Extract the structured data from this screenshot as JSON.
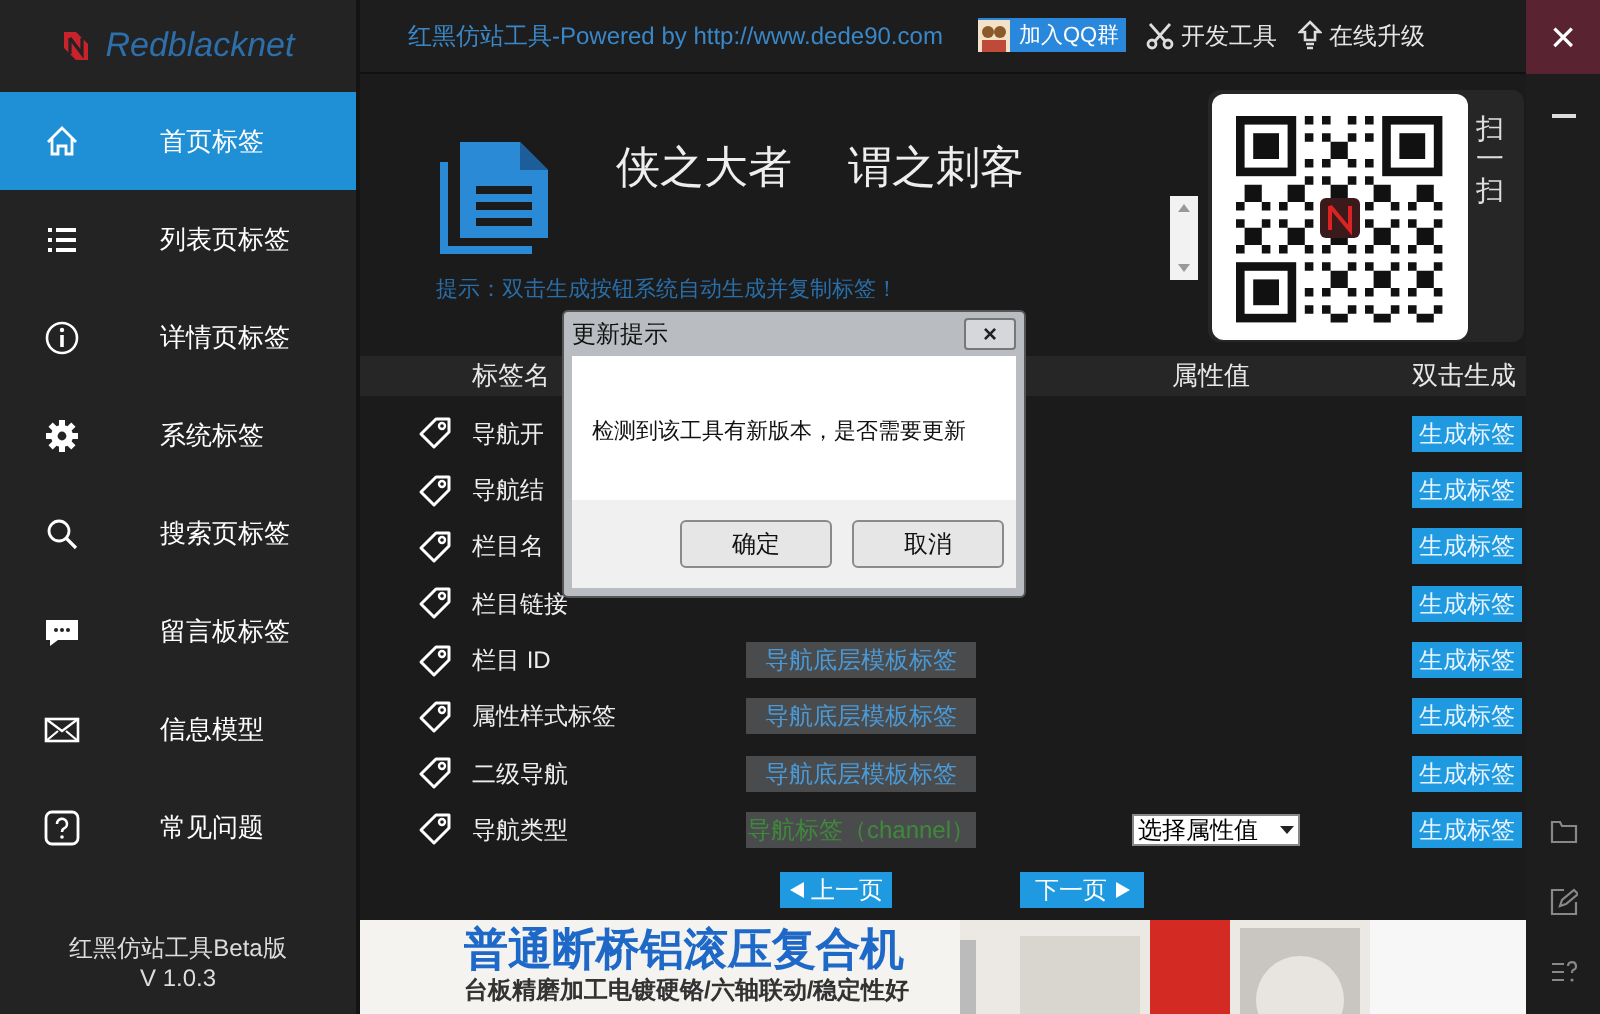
{
  "brand": {
    "name": "Redblacknet"
  },
  "title_bar": {
    "title": "红黑仿站工具-Powered by http://www.dede90.com",
    "qq_button": "加入QQ群",
    "tools": [
      {
        "label": "开发工具"
      },
      {
        "label": "在线升级"
      }
    ],
    "close": "×"
  },
  "sidebar": {
    "items": [
      {
        "label": "首页标签",
        "selected": true
      },
      {
        "label": "列表页标签",
        "selected": false
      },
      {
        "label": "详情页标签",
        "selected": false
      },
      {
        "label": "系统标签",
        "selected": false
      },
      {
        "label": "搜索页标签",
        "selected": false
      },
      {
        "label": "留言板标签",
        "selected": false
      },
      {
        "label": "信息模型",
        "selected": false
      },
      {
        "label": "常见问题",
        "selected": false
      }
    ],
    "footer": [
      "红黑仿站工具Beta版",
      "V 1.0.3"
    ]
  },
  "header": {
    "slogan": [
      "侠之大者",
      "谓之刺客"
    ],
    "scan_label": "扫一扫",
    "hint": "提示：双击生成按钮系统自动生成并复制标签！"
  },
  "table": {
    "columns": [
      "标签名",
      "属性值",
      "双击生成"
    ],
    "rows": [
      {
        "name": "导航开",
        "button": "生成标签"
      },
      {
        "name": "导航结",
        "button": "生成标签"
      },
      {
        "name": "栏目名",
        "button": "生成标签"
      },
      {
        "name": "栏目链接",
        "button": "生成标签"
      },
      {
        "name": "栏目 ID",
        "value": {
          "text": "导航底层模板标签",
          "kind": "template"
        },
        "button": "生成标签"
      },
      {
        "name": "属性样式标签",
        "value": {
          "text": "导航底层模板标签",
          "kind": "template"
        },
        "button": "生成标签"
      },
      {
        "name": "二级导航",
        "value": {
          "text": "导航底层模板标签",
          "kind": "template"
        },
        "button": "生成标签"
      },
      {
        "name": "导航类型",
        "value": {
          "text": "导航标签（channel）",
          "kind": "channel"
        },
        "select": "选择属性值",
        "button": "生成标签"
      }
    ]
  },
  "pagination": {
    "prev": "上一页",
    "next": "下一页"
  },
  "banner": {
    "headline": "普通断桥铝滚压复合机",
    "subline": "台板精磨加工电镀硬铬/六轴联动/稳定性好"
  },
  "dialog": {
    "title": "更新提示",
    "close": "×",
    "message": "检测到该工具有新版本，是否需要更新",
    "buttons": [
      "确定",
      "取消"
    ]
  }
}
